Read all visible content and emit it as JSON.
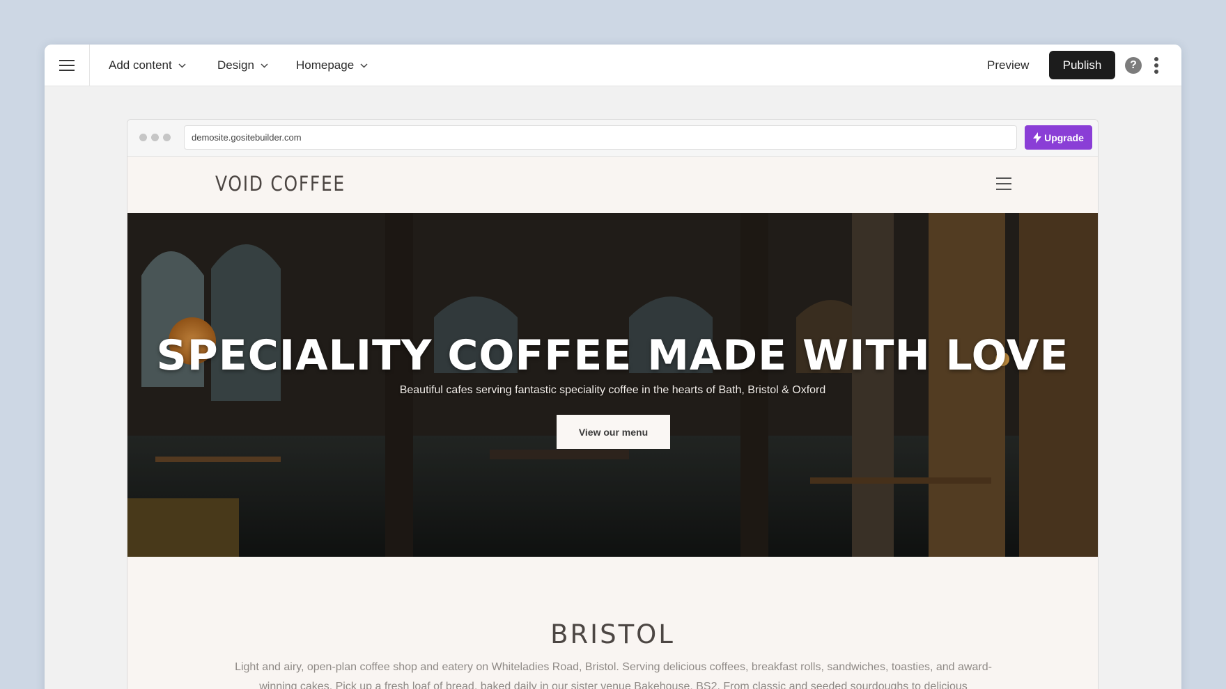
{
  "toolbar": {
    "add_content": "Add content",
    "design": "Design",
    "homepage": "Homepage",
    "preview": "Preview",
    "publish": "Publish",
    "help": "?"
  },
  "browser": {
    "url": "demosite.gositebuilder.com",
    "upgrade": "Upgrade"
  },
  "site": {
    "logo": "VOID COFFEE",
    "hero": {
      "title": "SPECIALITY COFFEE MADE WITH LOVE",
      "subtitle": "Beautiful cafes serving fantastic speciality coffee in the hearts of Bath, Bristol & Oxford",
      "cta": "View our menu"
    },
    "section": {
      "title": "BRISTOL",
      "body": "Light and airy, open-plan coffee shop and eatery on Whiteladies Road, Bristol. Serving delicious coffees, breakfast rolls, sandwiches, toasties, and award-winning cakes. Pick up a fresh loaf of bread, baked daily in our sister venue Bakehouse, BS2. From classic and seeded sourdoughs to delicious wholemeal, focaccia and more."
    }
  },
  "colors": {
    "background": "#cdd7e4",
    "publish": "#1c1c1c",
    "upgrade": "#8a3ed6",
    "site_bg": "#f9f5f2"
  },
  "icons": [
    "hamburger-menu-icon",
    "chevron-down-icon",
    "help-icon",
    "more-vertical-icon",
    "lightning-icon",
    "site-menu-icon"
  ]
}
